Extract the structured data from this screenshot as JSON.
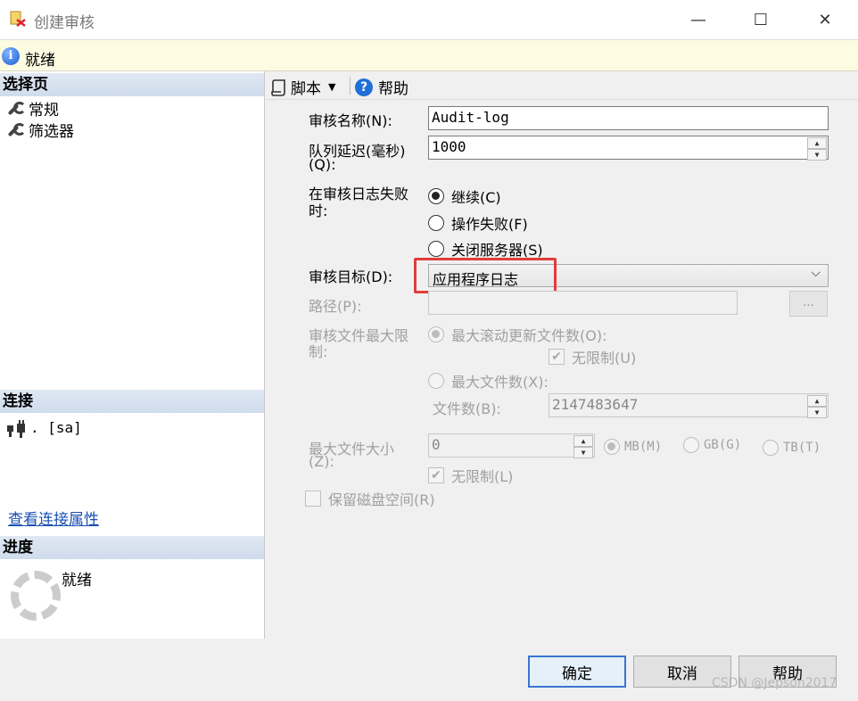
{
  "window": {
    "title": "创建审核",
    "min": "—",
    "max": "☐",
    "close": "✕"
  },
  "status": {
    "text": "就绪"
  },
  "left": {
    "select_page": "选择页",
    "nav": [
      "常规",
      "筛选器"
    ],
    "connection_header": "连接",
    "connection_value": ". [sa]",
    "connection_link": "查看连接属性",
    "progress_header": "进度",
    "progress_text": "就绪"
  },
  "toolbar": {
    "script": "脚本",
    "help": "帮助"
  },
  "form": {
    "audit_name_label": "审核名称(N):",
    "audit_name_value": "Audit-log",
    "queue_delay_label_1": "队列延迟(毫秒)",
    "queue_delay_label_2": "(Q):",
    "queue_delay_value": "1000",
    "on_failure_label_1": "在审核日志失败",
    "on_failure_label_2": "时:",
    "on_failure_options": [
      "继续(C)",
      "操作失败(F)",
      "关闭服务器(S)"
    ],
    "on_failure_selected": 0,
    "target_label": "审核目标(D):",
    "target_value": "应用程序日志",
    "path_label": "路径(P):",
    "path_browse": "...",
    "max_files_label_1": "审核文件最大限",
    "max_files_label_2": "制:",
    "max_rollover": "最大滚动更新文件数(O):",
    "unlimited_u": "无限制(U)",
    "max_files": "最大文件数(X):",
    "file_count_label": "文件数(B):",
    "file_count_value": "2147483647",
    "max_size_label_1": "最大文件大小",
    "max_size_label_2": "(Z):",
    "max_size_value": "0",
    "unit_mb": "MB(M)",
    "unit_gb": "GB(G)",
    "unit_tb": "TB(T)",
    "unlimited_l": "无限制(L)",
    "reserve_disk": "保留磁盘空间(R)"
  },
  "buttons": {
    "ok": "确定",
    "cancel": "取消",
    "help": "帮助"
  },
  "watermark": "CSDN @Jepson2017"
}
